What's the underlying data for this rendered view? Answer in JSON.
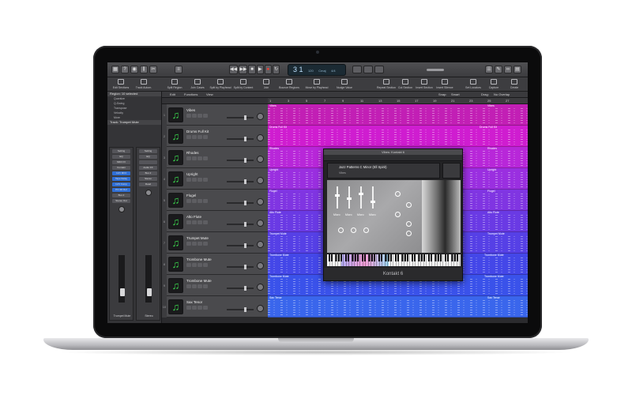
{
  "control_bar": {
    "lcd_bar": "3 1",
    "lcd_tempo": "120",
    "lcd_key": "Cmaj",
    "lcd_sig": "4/4"
  },
  "toolbar": {
    "tools": [
      "Edit Sections",
      "Track Autom.",
      "Split Region",
      "Join Cases",
      "Split by Playhead",
      "Split by Content",
      "Join",
      "Bounce Regions",
      "Move by Playhead",
      "Nudge Value",
      "Repeat Section",
      "Cut Section",
      "Insert Section",
      "Insert Silence",
      "Set Locators",
      "Capture",
      "Create"
    ]
  },
  "inspector": {
    "header": "Region: 10 selected",
    "rows": [
      "Quantize",
      "Q-Swing",
      "Transpose",
      "Velocity",
      "More"
    ],
    "track_header": "Track: Trumpet Mute",
    "strip_a_name": "Trumpet Mute",
    "strip_b_name": "Stereo",
    "slots_a": [
      "Setting",
      "EQ",
      "MIDI FX",
      "Kontakt",
      "Audio FX",
      "Bus 2",
      "Stereo Out",
      "Group"
    ],
    "slots_b": [
      "Setting",
      "EQ",
      "",
      "Audio FX",
      "Bus 2",
      "Stereo",
      "Read"
    ],
    "sends_blue": [
      "LVO MK3",
      "Tape Delay",
      "LVO Comp",
      "PO-3D Ref"
    ]
  },
  "tracks_menu": {
    "edit": "Edit",
    "functions": "Functions",
    "view": "View",
    "snap_label": "Snap:",
    "snap_value": "Smart",
    "drag_label": "Drag:",
    "drag_value": "No Overlap"
  },
  "ruler": [
    "1",
    "3",
    "5",
    "7",
    "9",
    "11",
    "13",
    "15",
    "17",
    "19",
    "21",
    "23",
    "25",
    "27"
  ],
  "tracks": [
    {
      "num": "1",
      "name": "Vibes"
    },
    {
      "num": "2",
      "name": "Drums Full Kit"
    },
    {
      "num": "3",
      "name": "Rhodes"
    },
    {
      "num": "4",
      "name": "Upright"
    },
    {
      "num": "5",
      "name": "Flugel"
    },
    {
      "num": "6",
      "name": "Alto Flute"
    },
    {
      "num": "7",
      "name": "Trumpet Mute"
    },
    {
      "num": "8",
      "name": "Trombone Mute"
    },
    {
      "num": "9",
      "name": "Trombone Mute"
    },
    {
      "num": "10",
      "name": "Sax Tenor"
    }
  ],
  "regions": [
    {
      "left": "Vibes",
      "right": "Vibes",
      "color": "#c21fb5"
    },
    {
      "left": "Drums Full Kit",
      "right": "Drums Full Kit",
      "color": "#cf1dd0"
    },
    {
      "left": "Rhodes",
      "right": "Rhodes",
      "color": "#b827d9"
    },
    {
      "left": "Upright",
      "right": "Upright",
      "color": "#9a2fe0"
    },
    {
      "left": "Flugel",
      "right": "Flugel",
      "color": "#8035e2"
    },
    {
      "left": "Alto Flute",
      "right": "Alto Flute",
      "color": "#6a3ae4"
    },
    {
      "left": "Trumpet Mute",
      "right": "Trumpet Mute",
      "color": "#5640e6"
    },
    {
      "left": "Trombone Mute",
      "right": "Trombone Mute",
      "color": "#4447e8"
    },
    {
      "left": "Trombone Mute",
      "right": "Trombone Mute",
      "color": "#3a52ea"
    },
    {
      "left": "Sax Tenor",
      "right": "Sax Tenor",
      "color": "#3a66ec"
    }
  ],
  "plugin": {
    "window_title": "Vibes: Kontakt 6",
    "instrument_name": "Jazz Patterns C Minor (Ell Spirit)",
    "view_label": "Vibes",
    "slider_labels": [
      "Micro",
      "Micro",
      "Micro",
      "Micro"
    ],
    "footer": "Kontakt 6"
  },
  "icons": {
    "track_instrument": "music-note-icon"
  }
}
